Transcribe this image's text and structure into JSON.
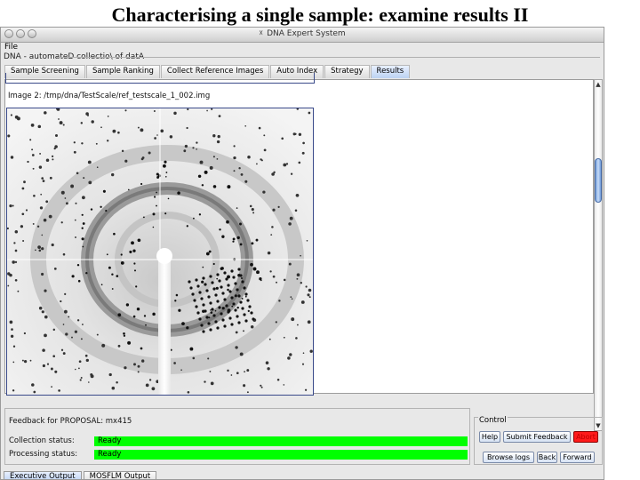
{
  "slide": {
    "title": "Characterising a single sample: examine results II"
  },
  "window": {
    "title": "DNA Expert System"
  },
  "menu": {
    "file": "File"
  },
  "panel": {
    "title": "DNA - automateD collectio\\ of datA"
  },
  "tabs": [
    {
      "label": "Sample Screening",
      "active": false
    },
    {
      "label": "Sample Ranking",
      "active": false
    },
    {
      "label": "Collect Reference Images",
      "active": false
    },
    {
      "label": "Auto Index",
      "active": false
    },
    {
      "label": "Strategy",
      "active": false
    },
    {
      "label": "Results",
      "active": true
    }
  ],
  "image": {
    "label": "Image 2: /tmp/dna/TestScale/ref_testscale_1_002.img"
  },
  "feedback": {
    "title": "Feedback for PROPOSAL: mx415",
    "collection_label": "Collection status:",
    "collection_value": "Ready",
    "processing_label": "Processing status:",
    "processing_value": "Ready",
    "status_color": "#00ff00"
  },
  "control": {
    "title": "Control",
    "help": "Help",
    "submit_feedback": "Submit Feedback",
    "abort": "Abort",
    "browse_logs": "Browse logs",
    "back": "Back",
    "forward": "Forward"
  },
  "bottom_tabs": [
    {
      "label": "Executive Output",
      "active": true
    },
    {
      "label": "MOSFLM Output",
      "active": false
    }
  ],
  "icons": {
    "window_close": "x-icon",
    "scroll_up": "arrow-up-icon",
    "scroll_down": "arrow-down-icon"
  }
}
